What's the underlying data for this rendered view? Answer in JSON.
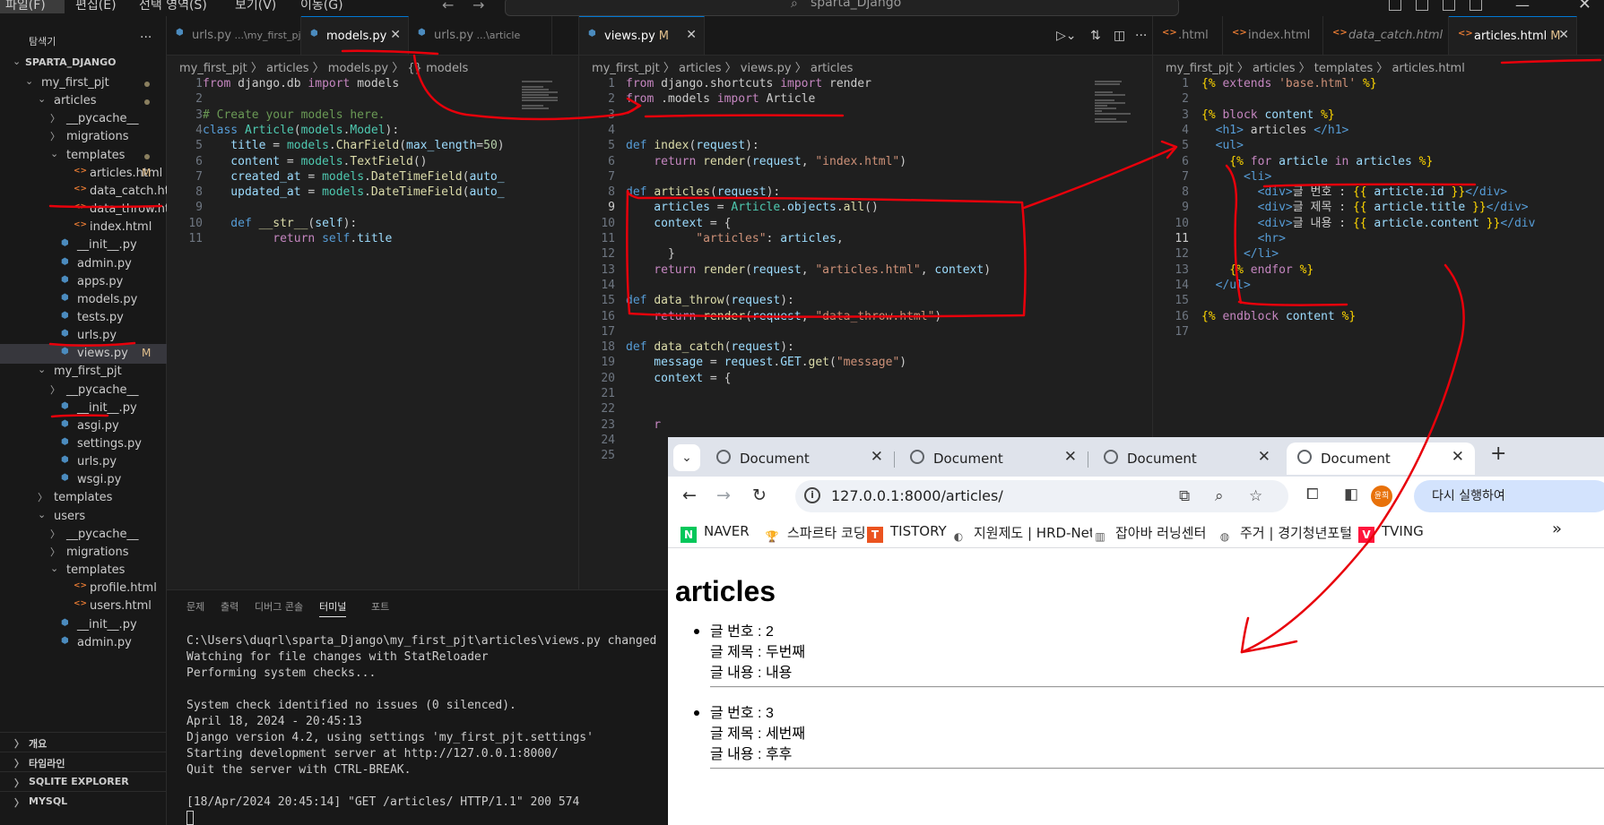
{
  "menu": [
    "파일(F)",
    "편집(E)",
    "선택 영역(S)",
    "보기(V)",
    "이동(G)"
  ],
  "command_center": "sparta_Django",
  "explorer": {
    "title": "탐색기",
    "root": "SPARTA_DJANGO",
    "tree": [
      {
        "label": "my_first_pjt",
        "type": "folder",
        "open": true,
        "depth": 1,
        "dot": true
      },
      {
        "label": "articles",
        "type": "folder",
        "open": true,
        "depth": 2,
        "dot": true
      },
      {
        "label": "__pycache__",
        "type": "folder",
        "open": false,
        "depth": 3
      },
      {
        "label": "migrations",
        "type": "folder",
        "open": false,
        "depth": 3
      },
      {
        "label": "templates",
        "type": "folder",
        "open": true,
        "depth": 3,
        "dot": true
      },
      {
        "label": "articles.html",
        "type": "html",
        "depth": 4,
        "badge": "M"
      },
      {
        "label": "data_catch.html",
        "type": "html",
        "depth": 4
      },
      {
        "label": "data_throw.html",
        "type": "html",
        "depth": 4
      },
      {
        "label": "index.html",
        "type": "html",
        "depth": 4
      },
      {
        "label": "__init__.py",
        "type": "py",
        "depth": 3
      },
      {
        "label": "admin.py",
        "type": "py",
        "depth": 3
      },
      {
        "label": "apps.py",
        "type": "py",
        "depth": 3
      },
      {
        "label": "models.py",
        "type": "py",
        "depth": 3
      },
      {
        "label": "tests.py",
        "type": "py",
        "depth": 3
      },
      {
        "label": "urls.py",
        "type": "py",
        "depth": 3
      },
      {
        "label": "views.py",
        "type": "py",
        "depth": 3,
        "badge": "M",
        "selected": true
      },
      {
        "label": "my_first_pjt",
        "type": "folder",
        "open": true,
        "depth": 2
      },
      {
        "label": "__pycache__",
        "type": "folder",
        "open": false,
        "depth": 3
      },
      {
        "label": "__init__.py",
        "type": "py",
        "depth": 3
      },
      {
        "label": "asgi.py",
        "type": "py",
        "depth": 3
      },
      {
        "label": "settings.py",
        "type": "py",
        "depth": 3
      },
      {
        "label": "urls.py",
        "type": "py",
        "depth": 3
      },
      {
        "label": "wsgi.py",
        "type": "py",
        "depth": 3
      },
      {
        "label": "templates",
        "type": "folder",
        "open": false,
        "depth": 2
      },
      {
        "label": "users",
        "type": "folder",
        "open": true,
        "depth": 2
      },
      {
        "label": "__pycache__",
        "type": "folder",
        "open": false,
        "depth": 3
      },
      {
        "label": "migrations",
        "type": "folder",
        "open": false,
        "depth": 3
      },
      {
        "label": "templates",
        "type": "folder",
        "open": true,
        "depth": 3
      },
      {
        "label": "profile.html",
        "type": "html",
        "depth": 4
      },
      {
        "label": "users.html",
        "type": "html",
        "depth": 4
      },
      {
        "label": "__init__.py",
        "type": "py",
        "depth": 3
      },
      {
        "label": "admin.py",
        "type": "py",
        "depth": 3
      }
    ],
    "sections": [
      "개요",
      "타임라인",
      "SQLITE EXPLORER",
      "MYSQL"
    ]
  },
  "editors": [
    {
      "tabs": [
        {
          "label": "urls.py",
          "hint": "...\\my_first_pjt",
          "type": "py"
        },
        {
          "label": "models.py",
          "type": "py",
          "active": true,
          "close": true
        },
        {
          "label": "urls.py",
          "hint": "...\\article",
          "type": "py"
        }
      ],
      "breadcrumb": "my_first_pjt 〉 articles 〉 models.py 〉 {} models",
      "lines": [
        [
          [
            "from ",
            "kw2"
          ],
          [
            "django.db ",
            ""
          ],
          [
            "import ",
            "kw2"
          ],
          [
            "models",
            ""
          ]
        ],
        [],
        [
          [
            "# Create your models here.",
            "cm"
          ]
        ],
        [
          [
            "class ",
            "kw"
          ],
          [
            "Article",
            "cls"
          ],
          [
            "(",
            ""
          ],
          [
            "models",
            "cls"
          ],
          [
            ".",
            ""
          ],
          [
            "Model",
            "cls"
          ],
          [
            "):",
            ""
          ]
        ],
        [
          [
            "    title ",
            "var"
          ],
          [
            "= ",
            ""
          ],
          [
            "models",
            "cls"
          ],
          [
            ".",
            ""
          ],
          [
            "CharField",
            "fn"
          ],
          [
            "(",
            ""
          ],
          [
            "max_length",
            "var"
          ],
          [
            "=",
            ""
          ],
          [
            "50",
            "num"
          ],
          [
            ")",
            ""
          ]
        ],
        [
          [
            "    content ",
            "var"
          ],
          [
            "= ",
            ""
          ],
          [
            "models",
            "cls"
          ],
          [
            ".",
            ""
          ],
          [
            "TextField",
            "fn"
          ],
          [
            "()",
            ""
          ]
        ],
        [
          [
            "    created_at ",
            "var"
          ],
          [
            "= ",
            ""
          ],
          [
            "models",
            "cls"
          ],
          [
            ".",
            ""
          ],
          [
            "DateTimeField",
            "fn"
          ],
          [
            "(",
            ""
          ],
          [
            "auto_",
            "var"
          ]
        ],
        [
          [
            "    updated_at ",
            "var"
          ],
          [
            "= ",
            ""
          ],
          [
            "models",
            "cls"
          ],
          [
            ".",
            ""
          ],
          [
            "DateTimeField",
            "fn"
          ],
          [
            "(",
            ""
          ],
          [
            "auto_",
            "var"
          ]
        ],
        [],
        [
          [
            "    def ",
            "kw"
          ],
          [
            "__str__",
            "fn"
          ],
          [
            "(",
            ""
          ],
          [
            "self",
            "var"
          ],
          [
            "):",
            ""
          ]
        ],
        [
          [
            "          return ",
            "kw2"
          ],
          [
            "self",
            "kw"
          ],
          [
            ".",
            ""
          ],
          [
            "title",
            "var"
          ]
        ]
      ],
      "line_count": 11
    },
    {
      "tabs": [
        {
          "label": "views.py",
          "type": "py",
          "active": true,
          "close": true,
          "badge": "M"
        }
      ],
      "breadcrumb": "my_first_pjt 〉 articles 〉 views.py 〉 articles",
      "lines": [
        [
          [
            "from ",
            "kw2"
          ],
          [
            "django.shortcuts ",
            ""
          ],
          [
            "import ",
            "kw2"
          ],
          [
            "render",
            ""
          ]
        ],
        [
          [
            "from ",
            "kw2"
          ],
          [
            ".models ",
            ""
          ],
          [
            "import ",
            "kw2"
          ],
          [
            "Article",
            ""
          ]
        ],
        [],
        [],
        [
          [
            "def ",
            "kw"
          ],
          [
            "index",
            "fn"
          ],
          [
            "(",
            ""
          ],
          [
            "request",
            "var"
          ],
          [
            "):",
            ""
          ]
        ],
        [
          [
            "    return ",
            "kw2"
          ],
          [
            "render",
            "fn"
          ],
          [
            "(",
            ""
          ],
          [
            "request",
            "var"
          ],
          [
            ", ",
            ""
          ],
          [
            "\"index.html\"",
            "str"
          ],
          [
            ")",
            ""
          ]
        ],
        [],
        [
          [
            "def ",
            "kw"
          ],
          [
            "articles",
            "fn"
          ],
          [
            "(",
            ""
          ],
          [
            "request",
            "var"
          ],
          [
            "):",
            ""
          ]
        ],
        [
          [
            "    articles ",
            "var"
          ],
          [
            "= ",
            ""
          ],
          [
            "Article",
            "cls"
          ],
          [
            ".",
            ""
          ],
          [
            "objects",
            "var"
          ],
          [
            ".",
            ""
          ],
          [
            "all",
            "fn"
          ],
          [
            "()",
            ""
          ]
        ],
        [
          [
            "    context ",
            "var"
          ],
          [
            "= {",
            ""
          ]
        ],
        [
          [
            "          \"articles\"",
            "str"
          ],
          [
            ": ",
            ""
          ],
          [
            "articles",
            "var"
          ],
          [
            ",",
            ""
          ]
        ],
        [
          [
            "      }",
            ""
          ]
        ],
        [
          [
            "    return ",
            "kw2"
          ],
          [
            "render",
            "fn"
          ],
          [
            "(",
            ""
          ],
          [
            "request",
            "var"
          ],
          [
            ", ",
            ""
          ],
          [
            "\"articles.html\"",
            "str"
          ],
          [
            ", ",
            ""
          ],
          [
            "context",
            "var"
          ],
          [
            ")",
            ""
          ]
        ],
        [],
        [
          [
            "def ",
            "kw"
          ],
          [
            "data_throw",
            "fn"
          ],
          [
            "(",
            ""
          ],
          [
            "request",
            "var"
          ],
          [
            "):",
            ""
          ]
        ],
        [
          [
            "    return ",
            "kw2"
          ],
          [
            "render",
            "fn"
          ],
          [
            "(",
            ""
          ],
          [
            "request",
            "var"
          ],
          [
            ", ",
            ""
          ],
          [
            "\"data_throw.html\"",
            "str"
          ],
          [
            ")",
            ""
          ]
        ],
        [],
        [
          [
            "def ",
            "kw"
          ],
          [
            "data_catch",
            "fn"
          ],
          [
            "(",
            ""
          ],
          [
            "request",
            "var"
          ],
          [
            "):",
            ""
          ]
        ],
        [
          [
            "    message ",
            "var"
          ],
          [
            "= ",
            ""
          ],
          [
            "request",
            "var"
          ],
          [
            ".",
            ""
          ],
          [
            "GET",
            "var"
          ],
          [
            ".",
            ""
          ],
          [
            "get",
            "fn"
          ],
          [
            "(",
            ""
          ],
          [
            "\"message\"",
            "str"
          ],
          [
            ")",
            ""
          ]
        ],
        [
          [
            "    context ",
            "var"
          ],
          [
            "= {",
            ""
          ]
        ],
        [],
        [],
        [
          [
            "    r",
            "kw2"
          ]
        ],
        [],
        []
      ],
      "line_count": 25,
      "current_line": 9
    },
    {
      "tabs": [
        {
          "label": ".html",
          "type": "html"
        },
        {
          "label": "index.html",
          "type": "html"
        },
        {
          "label": "data_catch.html",
          "type": "html",
          "italic": true
        },
        {
          "label": "articles.html",
          "type": "html",
          "active": true,
          "badge": "M",
          "close": true
        }
      ],
      "breadcrumb": "my_first_pjt 〉 articles 〉 templates 〉 articles.html",
      "lines": [
        [
          [
            "{% ",
            "tplb"
          ],
          [
            "extends ",
            "tpl"
          ],
          [
            "'base.html' ",
            "str"
          ],
          [
            "%}",
            "tplb"
          ]
        ],
        [],
        [
          [
            "{% ",
            "tplb"
          ],
          [
            "block ",
            "tpl"
          ],
          [
            "content ",
            "var"
          ],
          [
            "%}",
            "tplb"
          ]
        ],
        [
          [
            "  <h1>",
            "tag"
          ],
          [
            " articles ",
            ""
          ],
          [
            "</h1>",
            "tag"
          ]
        ],
        [
          [
            "  <ul>",
            "tag"
          ]
        ],
        [
          [
            "    {% ",
            "tplb"
          ],
          [
            "for ",
            "tpl"
          ],
          [
            "article ",
            "var"
          ],
          [
            "in ",
            "tpl"
          ],
          [
            "articles ",
            "var"
          ],
          [
            "%}",
            "tplb"
          ]
        ],
        [
          [
            "      <li>",
            "tag"
          ]
        ],
        [
          [
            "        <div>",
            "tag"
          ],
          [
            "글 번호 : ",
            ""
          ],
          [
            "{{ ",
            "tplb"
          ],
          [
            "article.id ",
            "var"
          ],
          [
            "}}",
            "tplb"
          ],
          [
            "</div>",
            "tag"
          ]
        ],
        [
          [
            "        <div>",
            "tag"
          ],
          [
            "글 제목 : ",
            ""
          ],
          [
            "{{ ",
            "tplb"
          ],
          [
            "article.title ",
            "var"
          ],
          [
            "}}",
            "tplb"
          ],
          [
            "</div>",
            "tag"
          ]
        ],
        [
          [
            "        <div>",
            "tag"
          ],
          [
            "글 내용 : ",
            ""
          ],
          [
            "{{ ",
            "tplb"
          ],
          [
            "article.content ",
            "var"
          ],
          [
            "}}",
            "tplb"
          ],
          [
            "</div",
            "tag"
          ]
        ],
        [
          [
            "        <hr>",
            "tag"
          ]
        ],
        [
          [
            "      </li>",
            "tag"
          ]
        ],
        [
          [
            "    {% ",
            "tplb"
          ],
          [
            "endfor ",
            "tpl"
          ],
          [
            "%}",
            "tplb"
          ]
        ],
        [
          [
            "  </ul>",
            "tag"
          ]
        ],
        [],
        [
          [
            "{% ",
            "tplb"
          ],
          [
            "endblock ",
            "tpl"
          ],
          [
            "content ",
            "var"
          ],
          [
            "%}",
            "tplb"
          ]
        ],
        []
      ],
      "line_count": 17,
      "current_line": 11
    }
  ],
  "panel": {
    "tabs": [
      "문제",
      "출력",
      "디버그 콘솔",
      "터미널",
      "포트"
    ],
    "active_tab": "터미널",
    "lines": [
      "C:\\Users\\duqrl\\sparta_Django\\my_first_pjt\\articles\\views.py changed",
      "Watching for file changes with StatReloader",
      "Performing system checks...",
      "",
      "System check identified no issues (0 silenced).",
      "April 18, 2024 - 20:45:13",
      "Django version 4.2, using settings 'my_first_pjt.settings'",
      "Starting development server at http://127.0.0.1:8000/",
      "Quit the server with CTRL-BREAK.",
      "",
      "[18/Apr/2024 20:45:14] \"GET /articles/ HTTP/1.1\" 200 574"
    ]
  },
  "browser": {
    "tabs": [
      "Document",
      "Document",
      "Document",
      "Document"
    ],
    "active_tab": 3,
    "url": "127.0.0.1:8000/articles/",
    "avatar": "윤희",
    "relaunch": "다시 실행하여",
    "bookmarks": [
      {
        "label": "NAVER",
        "icon": "N",
        "color": "#03c75a"
      },
      {
        "label": "스파르타 코딩",
        "icon": "🏆",
        "color": "#ffffff"
      },
      {
        "label": "TISTORY",
        "icon": "T",
        "color": "#eb531f"
      },
      {
        "label": "지원제도 | HRD-Net",
        "icon": "◐",
        "color": "#ffffff"
      },
      {
        "label": "잡아바 러닝센터",
        "icon": "▥",
        "color": "#ffffff"
      },
      {
        "label": "주거 | 경기청년포털",
        "icon": "◍",
        "color": "#ffffff"
      },
      {
        "label": "TVING",
        "icon": "V",
        "color": "#ff153c"
      }
    ],
    "page": {
      "title": "articles",
      "articles": [
        {
          "id_line": "글 번호 : 2",
          "title_line": "글 제목 : 두번째",
          "content_line": "글 내용 : 내용"
        },
        {
          "id_line": "글 번호 : 3",
          "title_line": "글 제목 : 세번째",
          "content_line": "글 내용 : 후후"
        }
      ]
    }
  }
}
